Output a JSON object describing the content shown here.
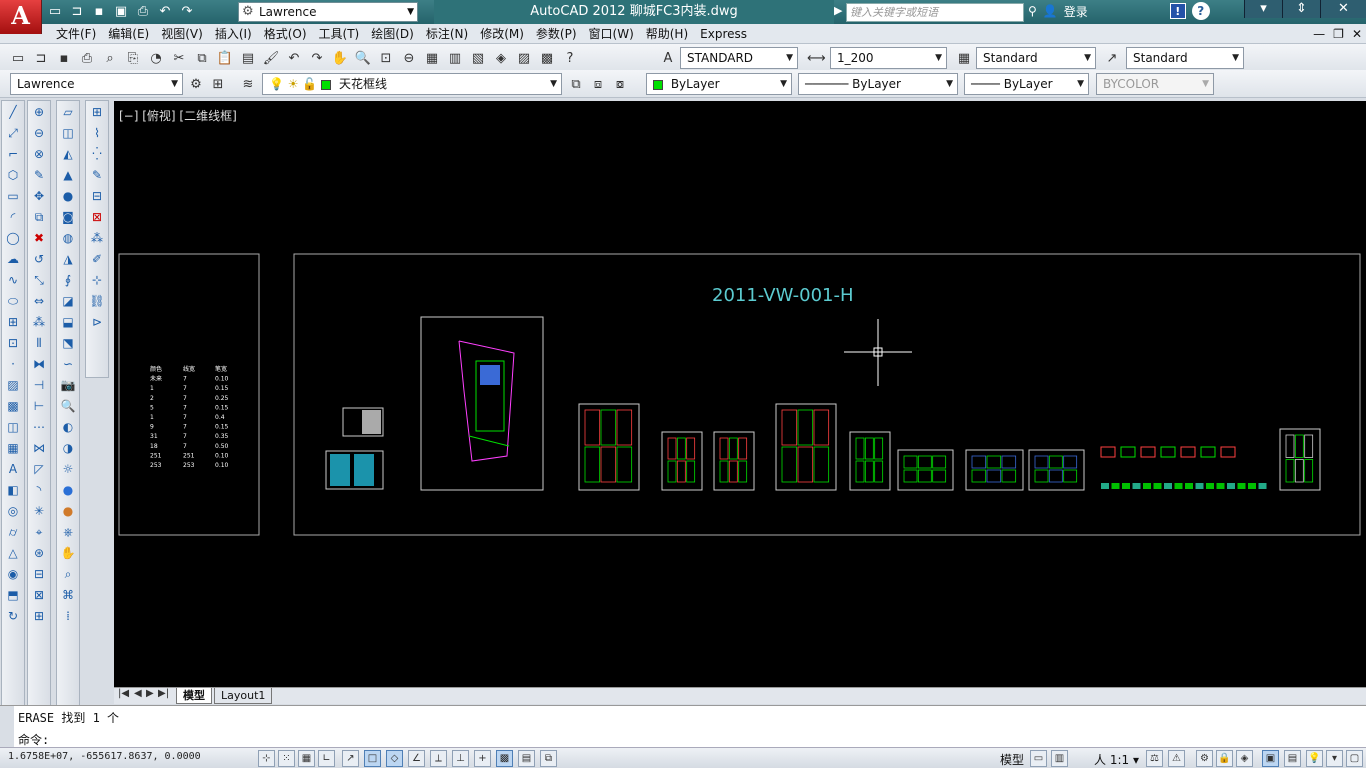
{
  "app": {
    "logo": "A",
    "title": "AutoCAD 2012    聊城FC3内装.dwg",
    "workspace": "Lawrence",
    "search_placeholder": "键入关键字或短语",
    "login": "登录",
    "help": "?",
    "info": "!"
  },
  "menu": [
    "文件(F)",
    "编辑(E)",
    "视图(V)",
    "插入(I)",
    "格式(O)",
    "工具(T)",
    "绘图(D)",
    "标注(N)",
    "修改(M)",
    "参数(P)",
    "窗口(W)",
    "帮助(H)",
    "Express"
  ],
  "window_controls": {
    "minimize": "▾",
    "restore": "⇕",
    "close": "✕"
  },
  "mdi_controls": [
    "—",
    "❐",
    "✕"
  ],
  "toolbar": {
    "text_style": "STANDARD",
    "dim_style": "1_200",
    "table_style": "Standard",
    "multileader_style": "Standard",
    "workspace2": "Lawrence",
    "layer": "天花框线",
    "color": "ByLayer",
    "linetype": "ByLayer",
    "lineweight": "ByLayer",
    "plotstyle": "BYCOLOR"
  },
  "drawing": {
    "viewport_label": "[−] [俯视] [二维线框]",
    "drawing_title": "2011-VW-001-H",
    "legend_table": [
      [
        "颜色",
        "线宽",
        "笔宽"
      ],
      [
        "未来",
        "7",
        "0.10"
      ],
      [
        "1",
        "7",
        "0.15"
      ],
      [
        "2",
        "7",
        "0.25"
      ],
      [
        "5",
        "7",
        "0.15"
      ],
      [
        "1",
        "7",
        "0.4"
      ],
      [
        "9",
        "7",
        "0.15"
      ],
      [
        "31",
        "7",
        "0.35"
      ],
      [
        "18",
        "7",
        "0.50"
      ],
      [
        "251",
        "251",
        "0.10"
      ],
      [
        "253",
        "253",
        "0.10"
      ]
    ]
  },
  "tabs": {
    "model": "模型",
    "layout1": "Layout1"
  },
  "command": {
    "history": "ERASE  找到 1 个",
    "prompt": "命令:"
  },
  "status": {
    "coords": "1.6758E+07, -655617.8637, 0.0000",
    "model": "模型",
    "scale": "人 1:1 ▾"
  }
}
